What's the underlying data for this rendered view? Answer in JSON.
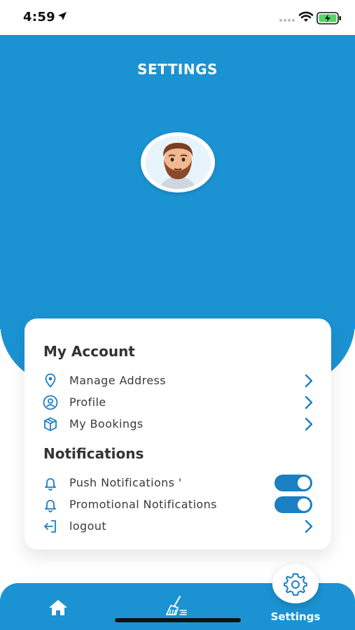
{
  "status_bar": {
    "time": "4:59"
  },
  "header": {
    "title": "SETTINGS",
    "background_color": "#1B93D2"
  },
  "account": {
    "section_title": "My Account",
    "items": [
      {
        "label": "Manage Address",
        "icon": "location-pin-icon"
      },
      {
        "label": "Profile",
        "icon": "profile-icon"
      },
      {
        "label": "My Bookings",
        "icon": "box-icon"
      }
    ]
  },
  "notifications": {
    "section_title": "Notifications",
    "items": [
      {
        "label": "Push Notifications '",
        "icon": "bell-icon",
        "enabled": true
      },
      {
        "label": "Promotional Notifications",
        "icon": "bell-icon",
        "enabled": true
      }
    ],
    "logout_label": "logout"
  },
  "bottom_nav": {
    "items": [
      {
        "name": "home",
        "icon": "home-icon"
      },
      {
        "name": "cleaning",
        "icon": "broom-icon"
      },
      {
        "name": "settings",
        "icon": "gear-icon",
        "label": "Settings",
        "active": true
      }
    ]
  }
}
